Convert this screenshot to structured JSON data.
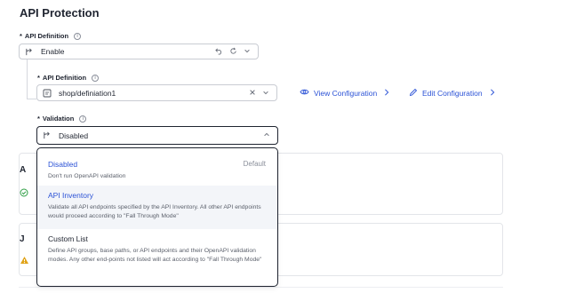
{
  "page": {
    "title": "API Protection"
  },
  "api_definition_toggle": {
    "label": "API Definition",
    "required_mark": "*",
    "value": "Enable",
    "icon": "branch-icon"
  },
  "api_definition": {
    "label": "API Definition",
    "required_mark": "*",
    "value": "shop/definiation1",
    "icon": "document-icon",
    "view_link": "View Configuration",
    "edit_link": "Edit Configuration"
  },
  "validation": {
    "label": "Validation",
    "required_mark": "*",
    "value": "Disabled",
    "icon": "branch-icon"
  },
  "validation_options": [
    {
      "title": "Disabled",
      "description": "Don't run OpenAPI validation",
      "badge": "Default",
      "selected": true
    },
    {
      "title": "API Inventory",
      "description": "Validate all API endpoints specified by the API Inventory. All other API endpoints would proceed according to \"Fall Through Mode\"",
      "highlighted": true
    },
    {
      "title": "Custom List",
      "description": "Define API groups, base paths, or API endpoints and their OpenAPI validation modes. Any other end-points not listed will act according to \"Fall Through Mode\""
    }
  ],
  "background_cards": [
    {
      "letter": "A",
      "icon": "check-circle-icon",
      "icon_color": "#2e9e44"
    },
    {
      "letter": "J",
      "icon": "warning-icon",
      "icon_color": "#e0a216"
    }
  ],
  "colors": {
    "link": "#2b52d6",
    "border_active": "#1f2430",
    "border": "#c9ccd3"
  }
}
